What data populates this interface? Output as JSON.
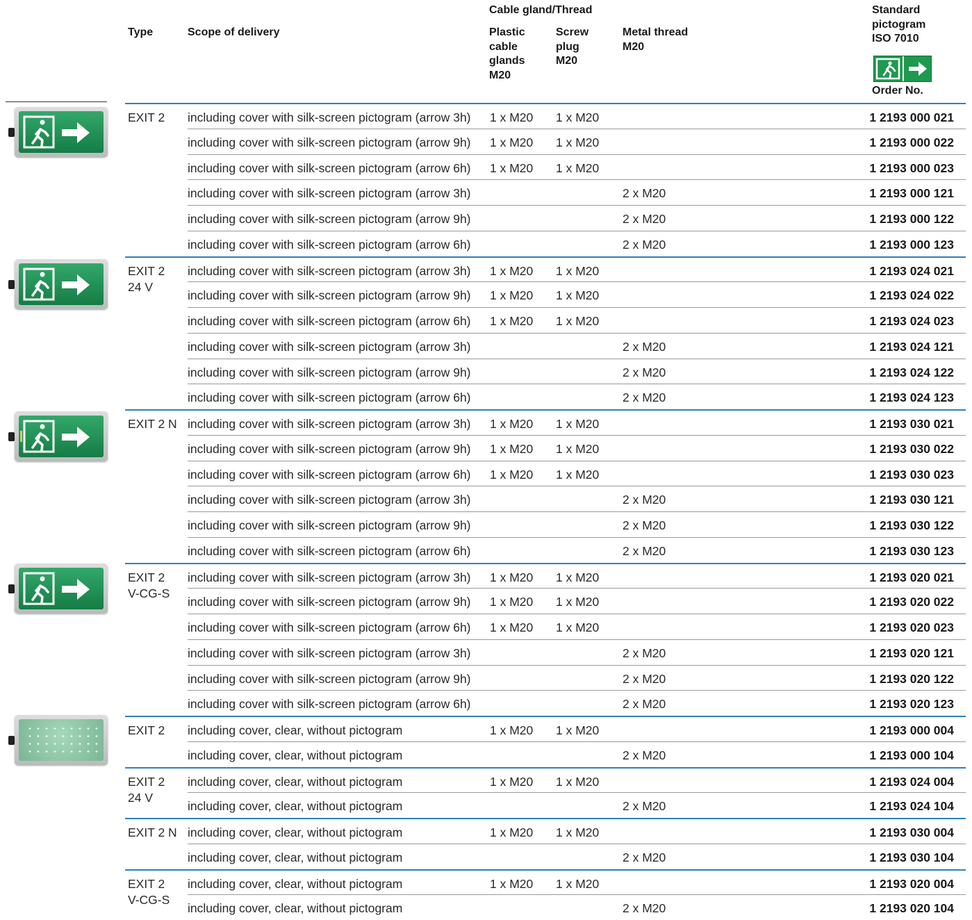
{
  "header": {
    "type": "Type",
    "scope": "Scope of delivery",
    "cable_group": "Cable gland/Thread",
    "plastic": [
      "Plastic",
      "cable",
      "glands",
      "M20"
    ],
    "screw": [
      "Screw",
      "plug",
      "M20"
    ],
    "metal": [
      "Metal thread",
      "M20"
    ],
    "standard": [
      "Standard",
      "pictogram",
      "ISO 7010"
    ],
    "order_no": "Order No."
  },
  "rows": [
    {
      "type": "EXIT 2",
      "scope": "including cover with silk-screen pictogram (arrow 3h)",
      "plastic": "1 x M20",
      "screw": "1 x M20",
      "metal": "",
      "order": "1 2193 000 021"
    },
    {
      "type": "",
      "scope": "including cover with silk-screen pictogram (arrow 9h)",
      "plastic": "1 x M20",
      "screw": "1 x M20",
      "metal": "",
      "order": "1 2193 000 022"
    },
    {
      "type": "",
      "scope": "including cover with silk-screen pictogram (arrow 6h)",
      "plastic": "1 x M20",
      "screw": "1 x M20",
      "metal": "",
      "order": "1 2193 000 023"
    },
    {
      "type": "",
      "scope": "including cover with silk-screen pictogram (arrow 3h)",
      "plastic": "",
      "screw": "",
      "metal": "2 x M20",
      "order": "1 2193 000 121"
    },
    {
      "type": "",
      "scope": "including cover with silk-screen pictogram (arrow 9h)",
      "plastic": "",
      "screw": "",
      "metal": "2 x M20",
      "order": "1 2193 000 122"
    },
    {
      "type": "",
      "scope": "including cover with silk-screen pictogram (arrow 6h)",
      "plastic": "",
      "screw": "",
      "metal": "2 x M20",
      "order": "1 2193 000 123"
    },
    {
      "type": "EXIT 2\n24 V",
      "scope": "including cover with silk-screen pictogram (arrow 3h)",
      "plastic": "1 x M20",
      "screw": "1 x M20",
      "metal": "",
      "order": "1 2193 024 021"
    },
    {
      "type": "",
      "scope": "including cover with silk-screen pictogram (arrow 9h)",
      "plastic": "1 x M20",
      "screw": "1 x M20",
      "metal": "",
      "order": "1 2193 024 022"
    },
    {
      "type": "",
      "scope": "including cover with silk-screen pictogram (arrow 6h)",
      "plastic": "1 x M20",
      "screw": "1 x M20",
      "metal": "",
      "order": "1 2193 024 023"
    },
    {
      "type": "",
      "scope": "including cover with silk-screen pictogram (arrow 3h)",
      "plastic": "",
      "screw": "",
      "metal": "2 x M20",
      "order": "1 2193 024 121"
    },
    {
      "type": "",
      "scope": "including cover with silk-screen pictogram (arrow 9h)",
      "plastic": "",
      "screw": "",
      "metal": "2 x M20",
      "order": "1 2193 024 122"
    },
    {
      "type": "",
      "scope": "including cover with silk-screen pictogram (arrow 6h)",
      "plastic": "",
      "screw": "",
      "metal": "2 x M20",
      "order": "1 2193 024 123"
    },
    {
      "type": "EXIT 2 N",
      "scope": "including cover with silk-screen pictogram (arrow 3h)",
      "plastic": "1 x M20",
      "screw": "1 x M20",
      "metal": "",
      "order": "1 2193 030 021"
    },
    {
      "type": "",
      "scope": "including cover with silk-screen pictogram (arrow 9h)",
      "plastic": "1 x M20",
      "screw": "1 x M20",
      "metal": "",
      "order": "1 2193 030 022"
    },
    {
      "type": "",
      "scope": "including cover with silk-screen pictogram (arrow 6h)",
      "plastic": "1 x M20",
      "screw": "1 x M20",
      "metal": "",
      "order": "1 2193 030 023"
    },
    {
      "type": "",
      "scope": "including cover with silk-screen pictogram (arrow 3h)",
      "plastic": "",
      "screw": "",
      "metal": "2 x M20",
      "order": "1 2193 030 121"
    },
    {
      "type": "",
      "scope": "including cover with silk-screen pictogram (arrow 9h)",
      "plastic": "",
      "screw": "",
      "metal": "2 x M20",
      "order": "1 2193 030 122"
    },
    {
      "type": "",
      "scope": "including cover with silk-screen pictogram (arrow 6h)",
      "plastic": "",
      "screw": "",
      "metal": "2 x M20",
      "order": "1 2193 030 123"
    },
    {
      "type": "EXIT 2\nV-CG-S",
      "scope": "including cover with silk-screen pictogram (arrow 3h)",
      "plastic": "1 x M20",
      "screw": "1 x M20",
      "metal": "",
      "order": "1 2193 020 021"
    },
    {
      "type": "",
      "scope": "including cover with silk-screen pictogram (arrow 9h)",
      "plastic": "1 x M20",
      "screw": "1 x M20",
      "metal": "",
      "order": "1 2193 020 022"
    },
    {
      "type": "",
      "scope": "including cover with silk-screen pictogram (arrow 6h)",
      "plastic": "1 x M20",
      "screw": "1 x M20",
      "metal": "",
      "order": "1 2193 020 023"
    },
    {
      "type": "",
      "scope": "including cover with silk-screen pictogram (arrow 3h)",
      "plastic": "",
      "screw": "",
      "metal": "2 x M20",
      "order": "1 2193 020 121"
    },
    {
      "type": "",
      "scope": "including cover with silk-screen pictogram (arrow 9h)",
      "plastic": "",
      "screw": "",
      "metal": "2 x M20",
      "order": "1 2193 020 122"
    },
    {
      "type": "",
      "scope": "including cover with silk-screen pictogram (arrow 6h)",
      "plastic": "",
      "screw": "",
      "metal": "2 x M20",
      "order": "1 2193 020 123"
    },
    {
      "type": "EXIT 2",
      "scope": "including cover, clear, without pictogram",
      "plastic": "1 x M20",
      "screw": "1 x M20",
      "metal": "",
      "order": "1 2193 000 004"
    },
    {
      "type": "",
      "scope": "including cover, clear, without pictogram",
      "plastic": "",
      "screw": "",
      "metal": "2 x M20",
      "order": "1 2193 000 104"
    },
    {
      "type": "EXIT 2\n24 V",
      "scope": "including cover, clear, without pictogram",
      "plastic": "1 x M20",
      "screw": "1 x M20",
      "metal": "",
      "order": "1 2193 024 004"
    },
    {
      "type": "",
      "scope": "including cover, clear, without pictogram",
      "plastic": "",
      "screw": "",
      "metal": "2 x M20",
      "order": "1 2193 024 104"
    },
    {
      "type": "EXIT 2 N",
      "scope": "including cover, clear, without pictogram",
      "plastic": "1 x M20",
      "screw": "1 x M20",
      "metal": "",
      "order": "1 2193 030 004"
    },
    {
      "type": "",
      "scope": "including cover, clear, without pictogram",
      "plastic": "",
      "screw": "",
      "metal": "2 x M20",
      "order": "1 2193 030 104"
    },
    {
      "type": "EXIT 2\nV-CG-S",
      "scope": "including cover, clear, without pictogram",
      "plastic": "1 x M20",
      "screw": "1 x M20",
      "metal": "",
      "order": "1 2193 020 004"
    },
    {
      "type": "",
      "scope": "including cover, clear, without pictogram",
      "plastic": "",
      "screw": "",
      "metal": "2 x M20",
      "order": "1 2193 020 104"
    }
  ],
  "colors": {
    "accent_rule": "#2f7fc1",
    "sign_green": "#1e9a4e"
  }
}
